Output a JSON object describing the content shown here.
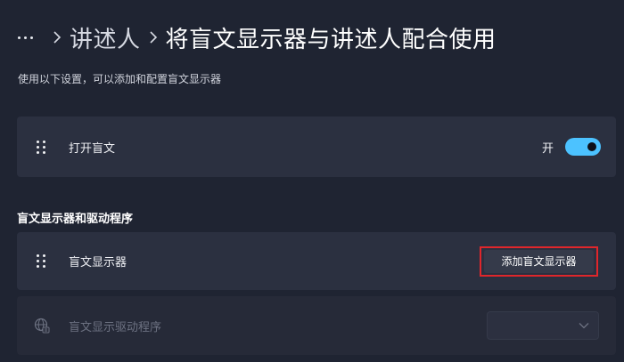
{
  "breadcrumb": {
    "more_icon": "more-horizontal-icon",
    "separator_icon": "chevron-right-icon",
    "parent": "讲述人",
    "current": "将盲文显示器与讲述人配合使用"
  },
  "subtitle": "使用以下设置，可以添加和配置盲文显示器",
  "braille_toggle_card": {
    "icon": "drag-handle-icon",
    "label": "打开盲文",
    "state_label": "开",
    "toggle_on": true
  },
  "section": {
    "heading": "盲文显示器和驱动程序"
  },
  "display_card": {
    "icon": "drag-handle-icon",
    "label": "盲文显示器",
    "button_label": "添加盲文显示器"
  },
  "driver_card": {
    "icon": "globe-icon",
    "label": "盲文显示驱动程序",
    "disabled": true,
    "dropdown_value": "",
    "dropdown_icon": "chevron-down-icon"
  },
  "colors": {
    "background": "#1f2432",
    "card": "#2b3040",
    "accent": "#4cc2ff",
    "highlight_border": "#e0262b"
  }
}
